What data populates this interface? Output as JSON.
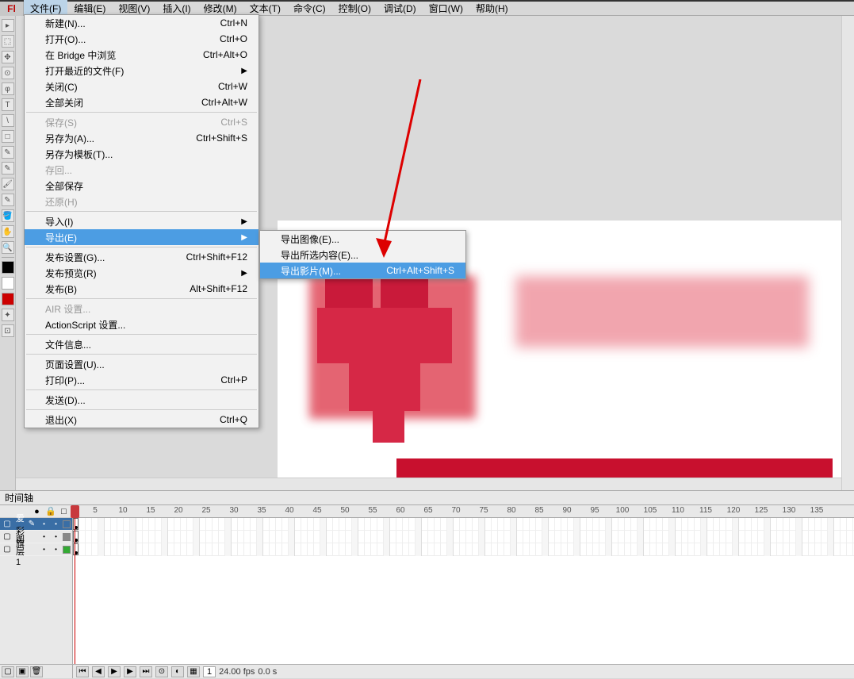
{
  "menubar": {
    "logo": "Fl",
    "items": [
      "文件(F)",
      "编辑(E)",
      "视图(V)",
      "插入(I)",
      "修改(M)",
      "文本(T)",
      "命令(C)",
      "控制(O)",
      "调试(D)",
      "窗口(W)",
      "帮助(H)"
    ]
  },
  "file_menu": {
    "groups": [
      [
        {
          "label": "新建(N)...",
          "shortcut": "Ctrl+N"
        },
        {
          "label": "打开(O)...",
          "shortcut": "Ctrl+O"
        },
        {
          "label": "在 Bridge 中浏览",
          "shortcut": "Ctrl+Alt+O"
        },
        {
          "label": "打开最近的文件(F)",
          "shortcut": "",
          "submenu": true
        },
        {
          "label": "关闭(C)",
          "shortcut": "Ctrl+W"
        },
        {
          "label": "全部关闭",
          "shortcut": "Ctrl+Alt+W"
        }
      ],
      [
        {
          "label": "保存(S)",
          "shortcut": "Ctrl+S",
          "disabled": true
        },
        {
          "label": "另存为(A)...",
          "shortcut": "Ctrl+Shift+S"
        },
        {
          "label": "另存为模板(T)...",
          "shortcut": ""
        },
        {
          "label": "存回...",
          "shortcut": "",
          "disabled": true
        },
        {
          "label": "全部保存",
          "shortcut": ""
        },
        {
          "label": "还原(H)",
          "shortcut": "",
          "disabled": true
        }
      ],
      [
        {
          "label": "导入(I)",
          "shortcut": "",
          "submenu": true
        },
        {
          "label": "导出(E)",
          "shortcut": "",
          "submenu": true,
          "highlighted": true
        }
      ],
      [
        {
          "label": "发布设置(G)...",
          "shortcut": "Ctrl+Shift+F12"
        },
        {
          "label": "发布预览(R)",
          "shortcut": "",
          "submenu": true
        },
        {
          "label": "发布(B)",
          "shortcut": "Alt+Shift+F12"
        }
      ],
      [
        {
          "label": "AIR 设置...",
          "shortcut": "",
          "disabled": true
        },
        {
          "label": "ActionScript 设置...",
          "shortcut": ""
        }
      ],
      [
        {
          "label": "文件信息...",
          "shortcut": ""
        }
      ],
      [
        {
          "label": "页面设置(U)...",
          "shortcut": ""
        },
        {
          "label": "打印(P)...",
          "shortcut": "Ctrl+P"
        }
      ],
      [
        {
          "label": "发送(D)...",
          "shortcut": ""
        }
      ],
      [
        {
          "label": "退出(X)",
          "shortcut": "Ctrl+Q"
        }
      ]
    ]
  },
  "export_submenu": [
    {
      "label": "导出图像(E)...",
      "shortcut": ""
    },
    {
      "label": "导出所选内容(E)...",
      "shortcut": ""
    },
    {
      "label": "导出影片(M)...",
      "shortcut": "Ctrl+Alt+Shift+S",
      "highlighted": true
    }
  ],
  "timeline": {
    "tab_label": "时间轴",
    "header_icons": {
      "eye": "●",
      "lock": "🔒",
      "outline": "□"
    },
    "layers": [
      {
        "name": "爱心",
        "selected": true,
        "color": "#3a6ea5",
        "pencil": true
      },
      {
        "name": "彩旗",
        "selected": false,
        "color": "#888888"
      },
      {
        "name": "图层 1",
        "selected": false,
        "color": "#33aa33"
      }
    ],
    "ruler_start": 5,
    "ruler_end": 135,
    "ruler_step": 5,
    "footer": {
      "frame": "1",
      "fps": "24.00 fps",
      "time": "0.0 s"
    }
  },
  "tools": [
    "▸",
    "⬚",
    "✥",
    "⊙",
    "φ",
    "T",
    "\\",
    "□",
    "✎",
    "✎",
    "🖌",
    "✎",
    "🪣",
    "✋",
    "🔍",
    "—",
    "⬛",
    "⬜",
    "⬛",
    "✦",
    "⊡"
  ]
}
